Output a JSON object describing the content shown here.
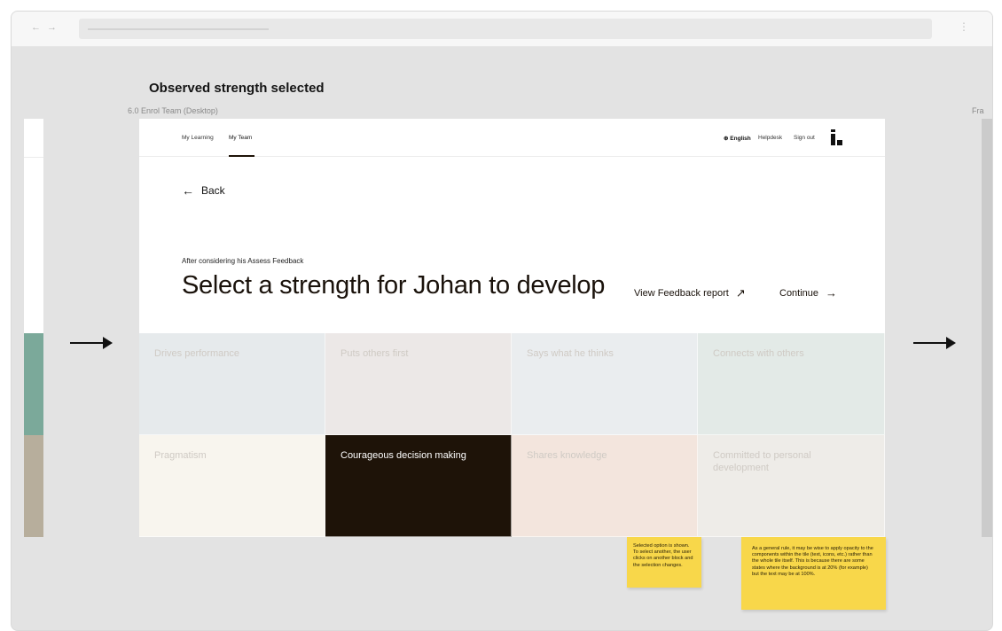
{
  "browser": {
    "nav_glyph": "← →",
    "menu_glyph": "⋮"
  },
  "canvas": {
    "frame_title": "Observed strength selected",
    "frame_label": "6.0 Enrol Team (Desktop)",
    "right_frame_label": "Fra"
  },
  "app": {
    "nav_tabs": [
      {
        "label": "My Learning",
        "active": false
      },
      {
        "label": "My Team",
        "active": true
      }
    ],
    "language": "English",
    "helpdesk": "Helpdesk",
    "signout": "Sign out",
    "back_label": "Back",
    "intro": "After considering his Assess Feedback",
    "headline": "Select a strength for Johan to develop",
    "view_report": "View Feedback report",
    "continue": "Continue"
  },
  "tiles": [
    {
      "label": "Drives performance",
      "color": "#e6eaec"
    },
    {
      "label": "Puts others first",
      "color": "#ece8e7"
    },
    {
      "label": "Says what he thinks",
      "color": "#eaedef"
    },
    {
      "label": "Connects with others",
      "color": "#e3eae7"
    },
    {
      "label": "Pragmatism",
      "color": "#f8f5ee"
    },
    {
      "label": "Courageous decision making",
      "color": "#1e1308",
      "selected": true
    },
    {
      "label": "Shares knowledge",
      "color": "#f3e5dd"
    },
    {
      "label": "Committed to personal development",
      "color": "#eeece8"
    }
  ],
  "notes": {
    "selected_note": "Selected option is shown. To select another, the user clicks on another block and the selection changes.",
    "opacity_note": "As a general rule, it may be wise to apply opacity to the components within the tile (text, icons, etc.) rather than the whole tile itself. This is because there are some states where the background is at 20% (for example) but the text may be at 100%."
  },
  "colors": {
    "selected_tile": "#1e1308",
    "sticky_note": "#f8d74a"
  }
}
